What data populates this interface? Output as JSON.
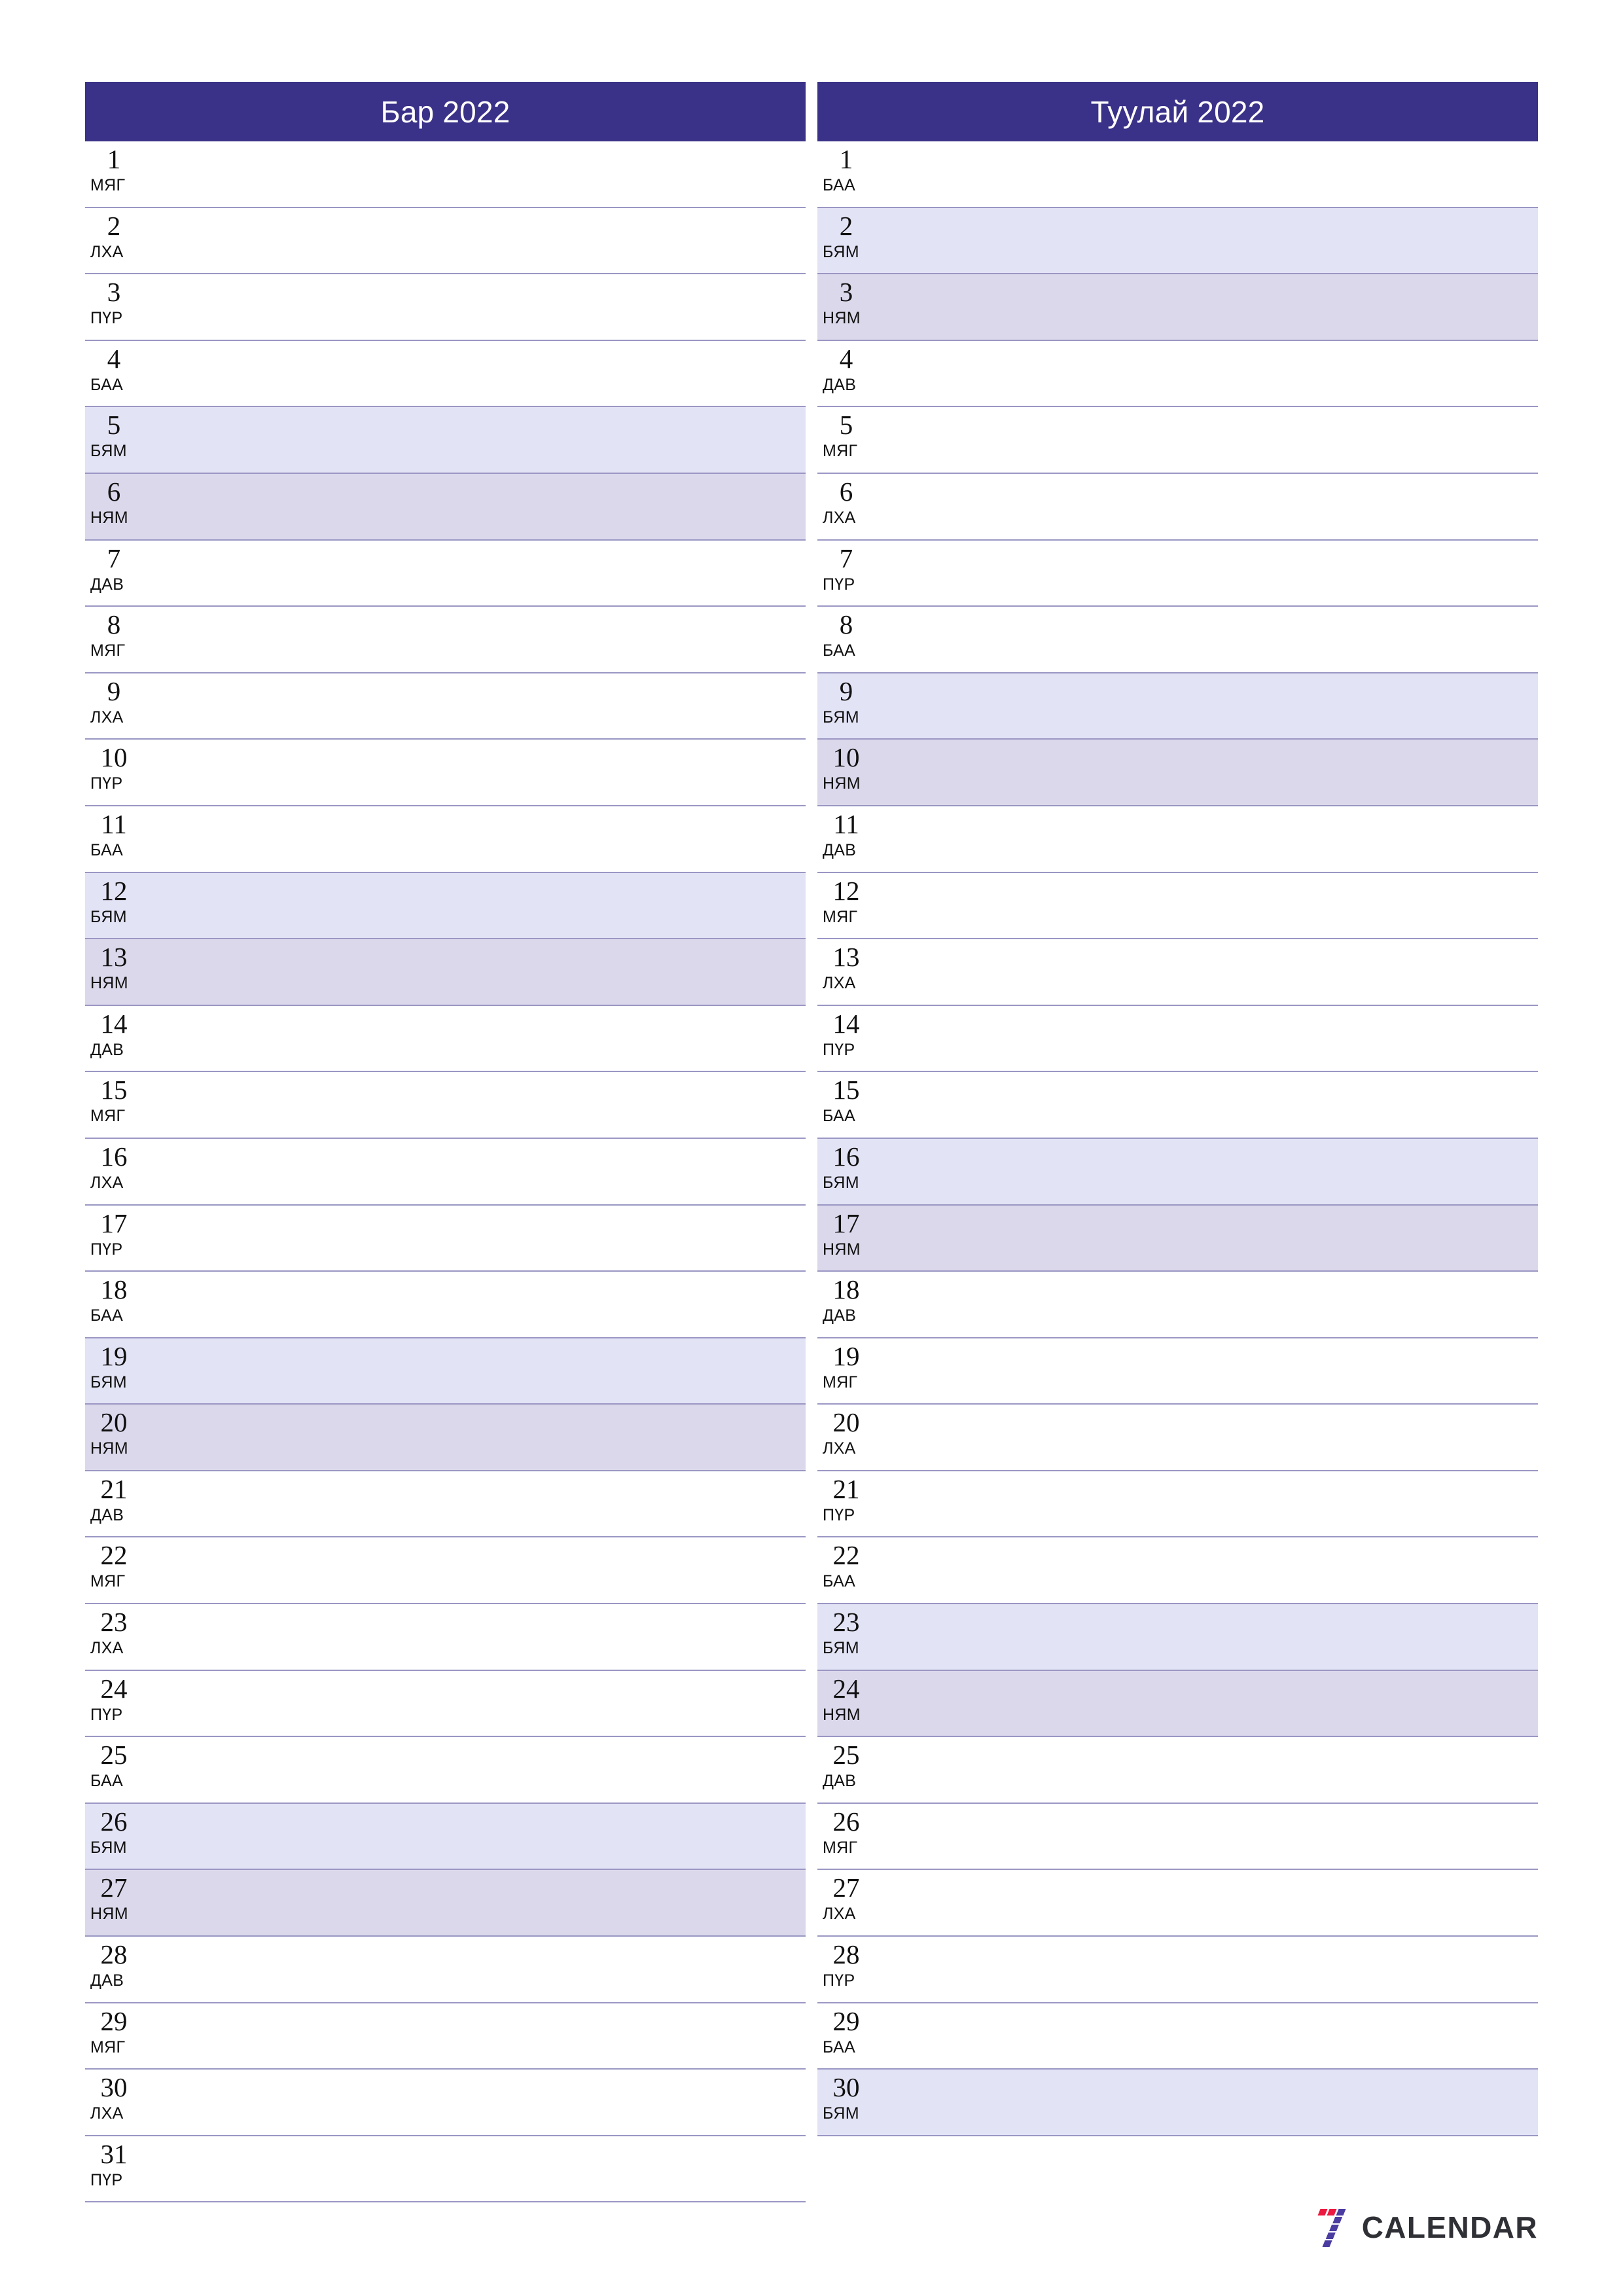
{
  "document": {
    "type": "printable-monthly-planner",
    "locale": "mn",
    "page_background": "#ffffff"
  },
  "theme": {
    "header_bg": "#3a3188",
    "header_text": "#ffffff",
    "row_border": "#9a97c4",
    "saturday_bg": "#e3e3f6",
    "sunday_bg": "#dcd8ec",
    "day_text": "#111111",
    "logo_red": "#ec1940",
    "logo_purple": "#4a3ca0",
    "logo_text": "#2f3035"
  },
  "weekday_labels": {
    "mon": "ДАВ",
    "tue": "МЯГ",
    "wed": "ЛХА",
    "thu": "ПҮР",
    "fri": "БАА",
    "sat": "БЯМ",
    "sun": "НЯМ"
  },
  "months": [
    {
      "title": "Бар 2022",
      "days": [
        {
          "num": "1",
          "wd": "МЯГ",
          "type": "weekday"
        },
        {
          "num": "2",
          "wd": "ЛХА",
          "type": "weekday"
        },
        {
          "num": "3",
          "wd": "ПҮР",
          "type": "weekday"
        },
        {
          "num": "4",
          "wd": "БАА",
          "type": "weekday"
        },
        {
          "num": "5",
          "wd": "БЯМ",
          "type": "sat"
        },
        {
          "num": "6",
          "wd": "НЯМ",
          "type": "sun"
        },
        {
          "num": "7",
          "wd": "ДАВ",
          "type": "weekday"
        },
        {
          "num": "8",
          "wd": "МЯГ",
          "type": "weekday"
        },
        {
          "num": "9",
          "wd": "ЛХА",
          "type": "weekday"
        },
        {
          "num": "10",
          "wd": "ПҮР",
          "type": "weekday"
        },
        {
          "num": "11",
          "wd": "БАА",
          "type": "weekday"
        },
        {
          "num": "12",
          "wd": "БЯМ",
          "type": "sat"
        },
        {
          "num": "13",
          "wd": "НЯМ",
          "type": "sun"
        },
        {
          "num": "14",
          "wd": "ДАВ",
          "type": "weekday"
        },
        {
          "num": "15",
          "wd": "МЯГ",
          "type": "weekday"
        },
        {
          "num": "16",
          "wd": "ЛХА",
          "type": "weekday"
        },
        {
          "num": "17",
          "wd": "ПҮР",
          "type": "weekday"
        },
        {
          "num": "18",
          "wd": "БАА",
          "type": "weekday"
        },
        {
          "num": "19",
          "wd": "БЯМ",
          "type": "sat"
        },
        {
          "num": "20",
          "wd": "НЯМ",
          "type": "sun"
        },
        {
          "num": "21",
          "wd": "ДАВ",
          "type": "weekday"
        },
        {
          "num": "22",
          "wd": "МЯГ",
          "type": "weekday"
        },
        {
          "num": "23",
          "wd": "ЛХА",
          "type": "weekday"
        },
        {
          "num": "24",
          "wd": "ПҮР",
          "type": "weekday"
        },
        {
          "num": "25",
          "wd": "БАА",
          "type": "weekday"
        },
        {
          "num": "26",
          "wd": "БЯМ",
          "type": "sat"
        },
        {
          "num": "27",
          "wd": "НЯМ",
          "type": "sun"
        },
        {
          "num": "28",
          "wd": "ДАВ",
          "type": "weekday"
        },
        {
          "num": "29",
          "wd": "МЯГ",
          "type": "weekday"
        },
        {
          "num": "30",
          "wd": "ЛХА",
          "type": "weekday"
        },
        {
          "num": "31",
          "wd": "ПҮР",
          "type": "weekday"
        }
      ]
    },
    {
      "title": "Туулай 2022",
      "days": [
        {
          "num": "1",
          "wd": "БАА",
          "type": "weekday"
        },
        {
          "num": "2",
          "wd": "БЯМ",
          "type": "sat"
        },
        {
          "num": "3",
          "wd": "НЯМ",
          "type": "sun"
        },
        {
          "num": "4",
          "wd": "ДАВ",
          "type": "weekday"
        },
        {
          "num": "5",
          "wd": "МЯГ",
          "type": "weekday"
        },
        {
          "num": "6",
          "wd": "ЛХА",
          "type": "weekday"
        },
        {
          "num": "7",
          "wd": "ПҮР",
          "type": "weekday"
        },
        {
          "num": "8",
          "wd": "БАА",
          "type": "weekday"
        },
        {
          "num": "9",
          "wd": "БЯМ",
          "type": "sat"
        },
        {
          "num": "10",
          "wd": "НЯМ",
          "type": "sun"
        },
        {
          "num": "11",
          "wd": "ДАВ",
          "type": "weekday"
        },
        {
          "num": "12",
          "wd": "МЯГ",
          "type": "weekday"
        },
        {
          "num": "13",
          "wd": "ЛХА",
          "type": "weekday"
        },
        {
          "num": "14",
          "wd": "ПҮР",
          "type": "weekday"
        },
        {
          "num": "15",
          "wd": "БАА",
          "type": "weekday"
        },
        {
          "num": "16",
          "wd": "БЯМ",
          "type": "sat"
        },
        {
          "num": "17",
          "wd": "НЯМ",
          "type": "sun"
        },
        {
          "num": "18",
          "wd": "ДАВ",
          "type": "weekday"
        },
        {
          "num": "19",
          "wd": "МЯГ",
          "type": "weekday"
        },
        {
          "num": "20",
          "wd": "ЛХА",
          "type": "weekday"
        },
        {
          "num": "21",
          "wd": "ПҮР",
          "type": "weekday"
        },
        {
          "num": "22",
          "wd": "БАА",
          "type": "weekday"
        },
        {
          "num": "23",
          "wd": "БЯМ",
          "type": "sat"
        },
        {
          "num": "24",
          "wd": "НЯМ",
          "type": "sun"
        },
        {
          "num": "25",
          "wd": "ДАВ",
          "type": "weekday"
        },
        {
          "num": "26",
          "wd": "МЯГ",
          "type": "weekday"
        },
        {
          "num": "27",
          "wd": "ЛХА",
          "type": "weekday"
        },
        {
          "num": "28",
          "wd": "ПҮР",
          "type": "weekday"
        },
        {
          "num": "29",
          "wd": "БАА",
          "type": "weekday"
        },
        {
          "num": "30",
          "wd": "БЯМ",
          "type": "sat"
        }
      ]
    }
  ],
  "brand": {
    "name": "CALENDAR",
    "mark": "seven-logo-icon"
  }
}
